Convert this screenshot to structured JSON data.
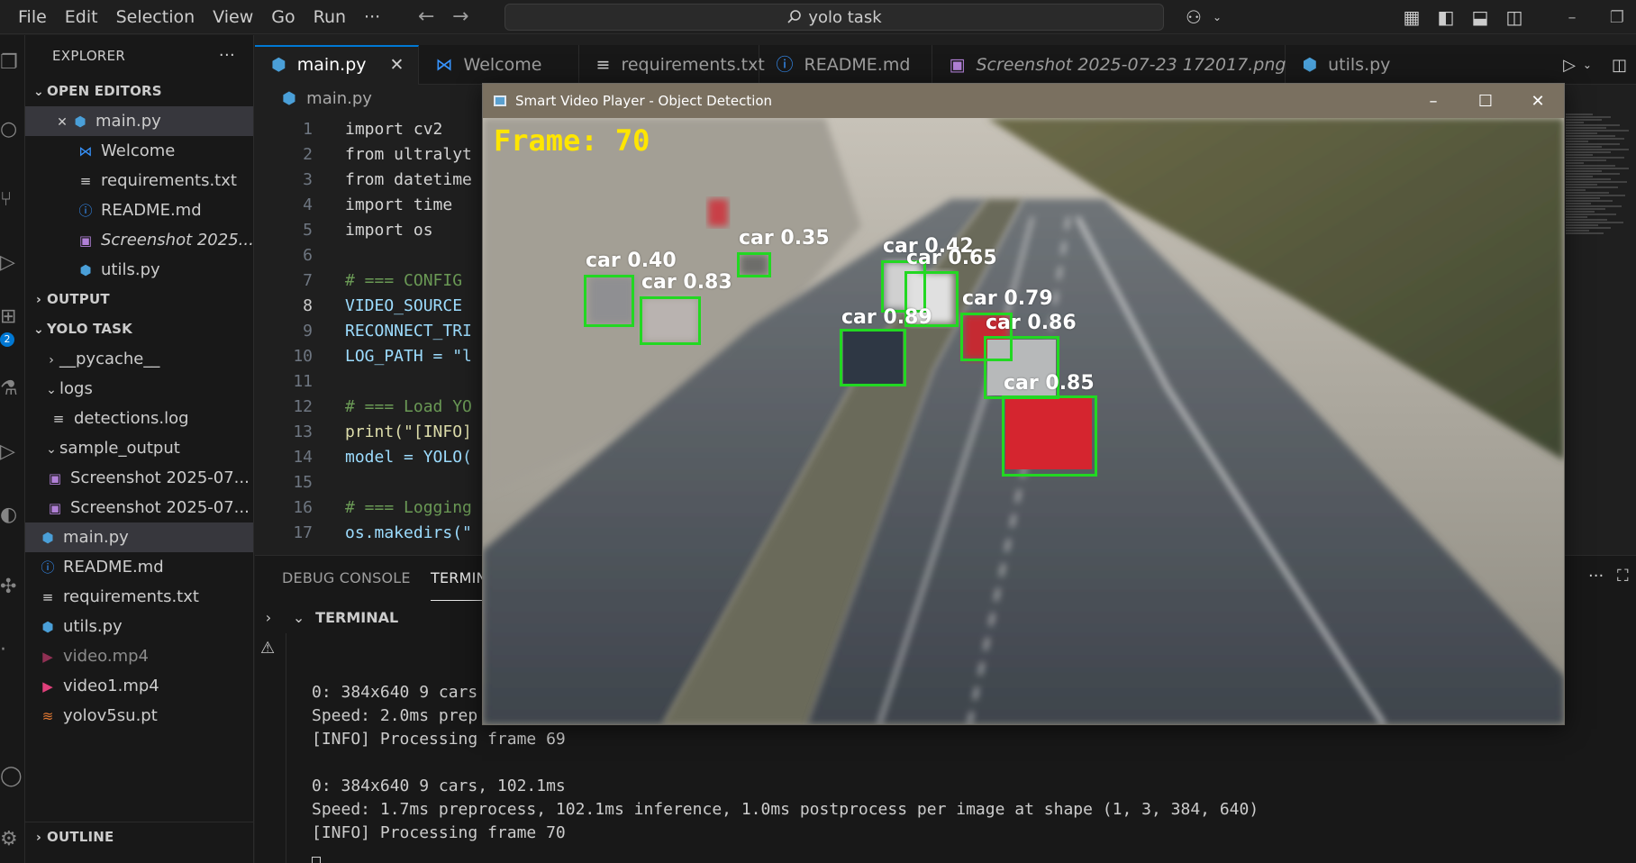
{
  "menu": [
    "File",
    "Edit",
    "Selection",
    "View",
    "Go",
    "Run",
    "···"
  ],
  "command_center": {
    "text": "yolo task"
  },
  "explorer": {
    "title": "EXPLORER",
    "more": "···",
    "open_editors_label": "OPEN EDITORS",
    "open_editors": [
      {
        "name": "main.py",
        "icon": "python-icon",
        "close": "✕"
      },
      {
        "name": "Welcome",
        "icon": "vscode-icon"
      },
      {
        "name": "requirements.txt",
        "icon": "text-file-icon"
      },
      {
        "name": "README.md",
        "icon": "info-icon"
      },
      {
        "name": "Screenshot 2025...",
        "icon": "image-icon"
      },
      {
        "name": "utils.py",
        "icon": "python-icon"
      }
    ],
    "output_label": "OUTPUT",
    "project_label": "YOLO TASK",
    "tree": [
      {
        "name": "__pycache__"
      },
      {
        "name": "logs"
      },
      {
        "name": "detections.log"
      },
      {
        "name": "sample_output"
      },
      {
        "name": "Screenshot 2025-07..."
      },
      {
        "name": "Screenshot 2025-07..."
      },
      {
        "name": "main.py"
      },
      {
        "name": "README.md"
      },
      {
        "name": "requirements.txt"
      },
      {
        "name": "utils.py"
      },
      {
        "name": "video.mp4"
      },
      {
        "name": "video1.mp4"
      },
      {
        "name": "yolov5su.pt"
      }
    ],
    "outline_label": "OUTLINE",
    "badge": "2"
  },
  "tabs": [
    {
      "label": "main.py",
      "close": "✕"
    },
    {
      "label": "Welcome"
    },
    {
      "label": "requirements.txt"
    },
    {
      "label": "README.md"
    },
    {
      "label": "Screenshot 2025-07-23 172017.png"
    },
    {
      "label": "utils.py"
    }
  ],
  "editor": {
    "breadcrumb": "main.py",
    "lines": [
      {
        "n": "1",
        "t": "import cv2"
      },
      {
        "n": "2",
        "t": "from ultralyt"
      },
      {
        "n": "3",
        "t": "from datetime"
      },
      {
        "n": "4",
        "t": "import time"
      },
      {
        "n": "5",
        "t": "import os"
      },
      {
        "n": "6",
        "t": ""
      },
      {
        "n": "7",
        "t": "# === CONFIG"
      },
      {
        "n": "8",
        "t": "VIDEO_SOURCE"
      },
      {
        "n": "9",
        "t": "RECONNECT_TRI"
      },
      {
        "n": "10",
        "t": "LOG_PATH = \"l"
      },
      {
        "n": "11",
        "t": ""
      },
      {
        "n": "12",
        "t": "# === Load YO"
      },
      {
        "n": "13",
        "t": "print(\"[INFO]"
      },
      {
        "n": "14",
        "t": "model = YOLO("
      },
      {
        "n": "15",
        "t": ""
      },
      {
        "n": "16",
        "t": "# === Logging"
      },
      {
        "n": "17",
        "t": "os.makedirs(\""
      }
    ]
  },
  "panel": {
    "tabs": [
      "DEBUG CONSOLE",
      "TERMIN"
    ],
    "terminal_label": "TERMINAL",
    "lines": [
      "0: 384x640 9 cars",
      "Speed: 2.0ms prep",
      "[INFO] Processing frame 69",
      "",
      "0: 384x640 9 cars, 102.1ms",
      "Speed: 1.7ms preprocess, 102.1ms inference, 1.0ms postprocess per image at shape (1, 3, 384, 640)",
      "[INFO] Processing frame 70"
    ]
  },
  "video_window": {
    "title": "Smart Video Player - Object Detection",
    "frame_label": "Frame: 70",
    "detections": [
      {
        "label": "car 0.40"
      },
      {
        "label": "car 0.83"
      },
      {
        "label": "car 0.35"
      },
      {
        "label": "car 0.42"
      },
      {
        "label": "car 0.65"
      },
      {
        "label": "car 0.89"
      },
      {
        "label": "car 0.79"
      },
      {
        "label": "car 0.86"
      },
      {
        "label": "car 0.85"
      }
    ],
    "box_color": "#22d822",
    "frame_label_color": "#ffe600"
  },
  "colors": {
    "accent": "#0078d4",
    "background": "#1f1f1f",
    "sidebar": "#181818"
  }
}
